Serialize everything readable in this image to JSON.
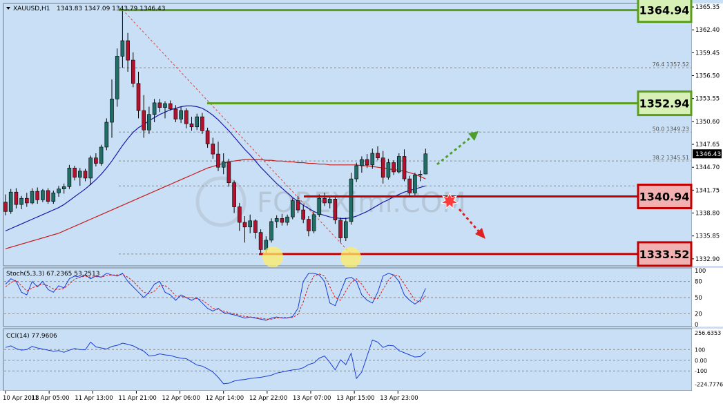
{
  "header": {
    "symbol_text": "XAUUSD,H1",
    "ohlc_text": "1343.83 1347.09 1343.79 1346.43"
  },
  "colors": {
    "panel_bg": "#c9dff5",
    "frame_bg": "#ffffff",
    "bull_candle": "#1f6e68",
    "bear_candle": "#b3122f",
    "ma_fast": "#1a1aa8",
    "ma_slow": "#c81c1c",
    "support_line": "#c00000",
    "resistance_line": "#5a9e1c",
    "fib_line": "#8a8a8a",
    "stoch_main": "#1a3cd6",
    "stoch_signal": "#e01919",
    "cci_line": "#1a3cd6"
  },
  "chart_data": [
    {
      "type": "candlestick",
      "panel": "price",
      "ylim": [
        1332.0,
        1365.8
      ],
      "y_ticks": [
        "1365.35",
        "1362.40",
        "1359.45",
        "1356.50",
        "1353.55",
        "1350.60",
        "1347.65",
        "1344.70",
        "1341.75",
        "1338.80",
        "1335.85",
        "1332.90"
      ],
      "current_price": "1346.43",
      "x_ticks": [
        "10 Apr 2018",
        "11 Apr 05:00",
        "11 Apr 13:00",
        "11 Apr 21:00",
        "12 Apr 06:00",
        "12 Apr 14:00",
        "12 Apr 22:00",
        "13 Apr 07:00",
        "13 Apr 15:00",
        "13 Apr 23:00"
      ],
      "candles": [
        [
          1340.2,
          1341.2,
          1338.5,
          1339.0
        ],
        [
          1339.0,
          1341.9,
          1338.7,
          1341.5
        ],
        [
          1341.5,
          1342.0,
          1339.4,
          1339.9
        ],
        [
          1339.9,
          1341.0,
          1339.3,
          1340.7
        ],
        [
          1340.7,
          1341.4,
          1339.6,
          1340.1
        ],
        [
          1340.1,
          1342.0,
          1339.9,
          1341.6
        ],
        [
          1341.6,
          1342.1,
          1340.0,
          1340.5
        ],
        [
          1340.5,
          1341.9,
          1340.2,
          1341.7
        ],
        [
          1341.7,
          1342.0,
          1340.0,
          1340.3
        ],
        [
          1340.3,
          1341.7,
          1340.0,
          1341.4
        ],
        [
          1341.4,
          1342.3,
          1340.9,
          1341.9
        ],
        [
          1341.9,
          1342.6,
          1341.3,
          1342.2
        ],
        [
          1342.2,
          1345.0,
          1341.9,
          1344.6
        ],
        [
          1344.6,
          1344.9,
          1343.0,
          1343.4
        ],
        [
          1343.4,
          1344.6,
          1342.3,
          1344.2
        ],
        [
          1344.2,
          1344.5,
          1342.9,
          1343.3
        ],
        [
          1343.3,
          1346.2,
          1342.4,
          1345.9
        ],
        [
          1345.9,
          1346.5,
          1344.8,
          1345.2
        ],
        [
          1345.2,
          1347.6,
          1344.9,
          1347.3
        ],
        [
          1347.3,
          1351.0,
          1346.9,
          1350.5
        ],
        [
          1350.5,
          1356.0,
          1348.5,
          1353.5
        ],
        [
          1353.5,
          1360.0,
          1352.5,
          1359.0
        ],
        [
          1359.0,
          1365.0,
          1357.5,
          1361.0
        ],
        [
          1361.0,
          1362.0,
          1357.0,
          1358.5
        ],
        [
          1358.5,
          1359.5,
          1355.0,
          1355.5
        ],
        [
          1355.5,
          1357.0,
          1351.0,
          1352.0
        ],
        [
          1352.0,
          1354.0,
          1348.5,
          1349.5
        ],
        [
          1349.5,
          1352.5,
          1349.0,
          1351.5
        ],
        [
          1351.5,
          1353.5,
          1350.5,
          1353.0
        ],
        [
          1353.0,
          1353.5,
          1351.8,
          1352.4
        ],
        [
          1352.4,
          1353.2,
          1351.0,
          1352.9
        ],
        [
          1352.9,
          1353.3,
          1352.0,
          1352.2
        ],
        [
          1352.2,
          1352.7,
          1350.5,
          1350.9
        ],
        [
          1350.9,
          1352.5,
          1350.4,
          1352.0
        ],
        [
          1352.0,
          1352.3,
          1349.7,
          1350.3
        ],
        [
          1350.3,
          1351.2,
          1349.4,
          1349.9
        ],
        [
          1349.9,
          1351.6,
          1349.5,
          1351.2
        ],
        [
          1351.2,
          1351.7,
          1349.0,
          1349.4
        ],
        [
          1349.4,
          1349.8,
          1347.2,
          1347.7
        ],
        [
          1347.7,
          1348.5,
          1345.8,
          1346.4
        ],
        [
          1346.4,
          1348.0,
          1344.2,
          1344.7
        ],
        [
          1344.7,
          1346.5,
          1343.8,
          1345.4
        ],
        [
          1345.4,
          1345.8,
          1342.2,
          1342.7
        ],
        [
          1342.7,
          1343.0,
          1338.8,
          1339.6
        ],
        [
          1339.6,
          1340.1,
          1336.5,
          1337.6
        ],
        [
          1337.6,
          1338.4,
          1335.0,
          1337.0
        ],
        [
          1337.0,
          1338.6,
          1336.2,
          1337.8
        ],
        [
          1337.8,
          1338.0,
          1335.5,
          1336.3
        ],
        [
          1336.3,
          1336.7,
          1333.5,
          1334.1
        ],
        [
          1334.1,
          1335.8,
          1333.52,
          1335.3
        ],
        [
          1335.3,
          1338.1,
          1335.0,
          1337.7
        ],
        [
          1337.7,
          1338.5,
          1336.9,
          1338.1
        ],
        [
          1338.1,
          1338.7,
          1337.2,
          1337.6
        ],
        [
          1337.6,
          1338.6,
          1337.2,
          1338.3
        ],
        [
          1338.3,
          1340.7,
          1338.0,
          1340.4
        ],
        [
          1340.4,
          1341.0,
          1338.8,
          1339.2
        ],
        [
          1339.2,
          1339.9,
          1337.5,
          1338.0
        ],
        [
          1338.0,
          1338.4,
          1335.8,
          1336.5
        ],
        [
          1336.5,
          1339.0,
          1336.2,
          1338.6
        ],
        [
          1338.6,
          1341.2,
          1338.3,
          1340.7
        ],
        [
          1340.7,
          1341.4,
          1339.7,
          1340.1
        ],
        [
          1340.1,
          1341.0,
          1339.4,
          1340.6
        ],
        [
          1340.6,
          1340.9,
          1337.4,
          1337.9
        ],
        [
          1337.9,
          1338.2,
          1335.0,
          1335.6
        ],
        [
          1335.6,
          1338.2,
          1335.2,
          1337.7
        ],
        [
          1337.7,
          1344.0,
          1337.3,
          1343.2
        ],
        [
          1343.2,
          1345.3,
          1342.8,
          1344.9
        ],
        [
          1344.9,
          1346.1,
          1344.0,
          1345.7
        ],
        [
          1345.7,
          1346.4,
          1344.6,
          1345.0
        ],
        [
          1345.0,
          1347.1,
          1344.5,
          1346.5
        ],
        [
          1346.5,
          1347.4,
          1345.6,
          1345.9
        ],
        [
          1345.9,
          1346.8,
          1342.6,
          1343.4
        ],
        [
          1343.4,
          1345.8,
          1343.1,
          1345.3
        ],
        [
          1345.3,
          1345.6,
          1343.7,
          1344.1
        ],
        [
          1344.1,
          1346.5,
          1343.9,
          1346.1
        ],
        [
          1346.1,
          1347.0,
          1342.9,
          1343.2
        ],
        [
          1343.2,
          1343.6,
          1340.9,
          1341.4
        ],
        [
          1341.4,
          1344.0,
          1341.1,
          1343.7
        ],
        [
          1343.7,
          1344.3,
          1342.9,
          1343.8
        ],
        [
          1343.83,
          1347.09,
          1343.79,
          1346.43
        ]
      ],
      "ma_fast": [
        1336.5,
        1336.8,
        1337.1,
        1337.4,
        1337.7,
        1338.0,
        1338.3,
        1338.6,
        1338.9,
        1339.2,
        1339.5,
        1339.9,
        1340.4,
        1340.9,
        1341.4,
        1341.9,
        1342.5,
        1343.1,
        1343.8,
        1344.6,
        1345.5,
        1346.5,
        1347.5,
        1348.4,
        1349.2,
        1349.8,
        1350.2,
        1350.7,
        1351.1,
        1351.5,
        1351.8,
        1352.1,
        1352.3,
        1352.5,
        1352.6,
        1352.6,
        1352.5,
        1352.3,
        1351.9,
        1351.4,
        1350.8,
        1350.1,
        1349.4,
        1348.6,
        1347.8,
        1347.0,
        1346.3,
        1345.5,
        1344.7,
        1344.0,
        1343.3,
        1342.6,
        1342.0,
        1341.4,
        1340.8,
        1340.3,
        1339.8,
        1339.4,
        1339.0,
        1338.7,
        1338.5,
        1338.3,
        1338.2,
        1338.1,
        1338.1,
        1338.2,
        1338.4,
        1338.7,
        1339.0,
        1339.4,
        1339.8,
        1340.2,
        1340.5,
        1340.9,
        1341.2,
        1341.5,
        1341.7,
        1341.9,
        1342.1,
        1342.3
      ],
      "ma_slow": [
        1334.2,
        1334.4,
        1334.6,
        1334.8,
        1335.0,
        1335.2,
        1335.4,
        1335.6,
        1335.8,
        1336.0,
        1336.2,
        1336.5,
        1336.8,
        1337.1,
        1337.4,
        1337.7,
        1338.0,
        1338.3,
        1338.6,
        1338.9,
        1339.2,
        1339.5,
        1339.8,
        1340.1,
        1340.4,
        1340.7,
        1341.0,
        1341.3,
        1341.6,
        1341.9,
        1342.2,
        1342.5,
        1342.8,
        1343.1,
        1343.4,
        1343.7,
        1344.0,
        1344.3,
        1344.6,
        1344.8,
        1345.0,
        1345.2,
        1345.4,
        1345.5,
        1345.6,
        1345.7,
        1345.7,
        1345.7,
        1345.7,
        1345.6,
        1345.6,
        1345.5,
        1345.5,
        1345.4,
        1345.4,
        1345.3,
        1345.3,
        1345.2,
        1345.2,
        1345.1,
        1345.1,
        1345.0,
        1345.0,
        1345.0,
        1345.0,
        1345.0,
        1345.0,
        1344.9,
        1344.9,
        1344.8,
        1344.7,
        1344.6,
        1344.5,
        1344.4,
        1344.3,
        1344.2,
        1344.0,
        1343.8,
        1343.5,
        1343.2
      ],
      "levels": [
        {
          "value": 1364.94,
          "label": "1364.94",
          "kind": "resistance"
        },
        {
          "value": 1352.94,
          "label": "1352.94",
          "kind": "resistance"
        },
        {
          "value": 1340.94,
          "label": "1340.94",
          "kind": "support"
        },
        {
          "value": 1333.52,
          "label": "1333.52",
          "kind": "support"
        }
      ],
      "fib_levels": [
        {
          "value": 1357.52,
          "label": "76.4 1357.52"
        },
        {
          "value": 1349.23,
          "label": "50.0 1349.23"
        },
        {
          "value": 1345.51,
          "label": "38.2 1345.51"
        },
        {
          "value": 1342.3,
          "label": ""
        },
        {
          "value": 1333.52,
          "label": ""
        }
      ],
      "watermark": "FOREXimf.COM"
    },
    {
      "type": "line",
      "panel": "stochastic",
      "label": "Stoch(5,3,3) 67.2365 53.2513",
      "ylim": [
        0,
        100
      ],
      "y_ticks": [
        "100",
        "80",
        "50",
        "20",
        "0"
      ],
      "series": [
        {
          "name": "main",
          "values": [
            75,
            85,
            80,
            60,
            55,
            80,
            70,
            80,
            65,
            60,
            72,
            68,
            85,
            90,
            88,
            92,
            85,
            90,
            88,
            95,
            92,
            90,
            95,
            80,
            70,
            60,
            50,
            60,
            75,
            80,
            60,
            55,
            45,
            55,
            50,
            45,
            50,
            40,
            30,
            25,
            30,
            22,
            20,
            18,
            15,
            12,
            14,
            12,
            10,
            8,
            12,
            14,
            12,
            12,
            15,
            30,
            80,
            95,
            95,
            92,
            80,
            40,
            35,
            60,
            85,
            88,
            80,
            55,
            45,
            40,
            60,
            90,
            95,
            92,
            80,
            55,
            45,
            38,
            45,
            67.2365
          ]
        },
        {
          "name": "signal",
          "values": [
            70,
            78,
            82,
            72,
            62,
            68,
            72,
            75,
            72,
            66,
            65,
            67,
            75,
            84,
            88,
            90,
            88,
            89,
            88,
            91,
            92,
            92,
            93,
            88,
            80,
            70,
            60,
            57,
            62,
            72,
            72,
            65,
            53,
            52,
            50,
            50,
            48,
            45,
            38,
            30,
            28,
            25,
            22,
            20,
            17,
            15,
            14,
            13,
            12,
            10,
            10,
            12,
            13,
            13,
            13,
            19,
            42,
            72,
            90,
            94,
            90,
            70,
            50,
            45,
            62,
            78,
            85,
            75,
            60,
            48,
            48,
            65,
            82,
            92,
            90,
            75,
            60,
            45,
            42,
            53.2513
          ]
        }
      ]
    },
    {
      "type": "line",
      "panel": "cci",
      "label": "CCI(14) 77.9606",
      "ylim": [
        -260,
        270
      ],
      "y_ticks": [
        "256.6353",
        "100",
        "0.00",
        "-100",
        "-224.7776"
      ],
      "series": [
        {
          "name": "cci",
          "values": [
            120,
            135,
            110,
            95,
            100,
            130,
            115,
            105,
            95,
            85,
            90,
            75,
            95,
            110,
            100,
            98,
            170,
            125,
            115,
            105,
            130,
            140,
            160,
            150,
            135,
            110,
            85,
            40,
            45,
            60,
            50,
            45,
            30,
            20,
            15,
            -15,
            -45,
            -55,
            -80,
            -110,
            -160,
            -220,
            -215,
            -195,
            -185,
            -180,
            -170,
            -165,
            -160,
            -150,
            -140,
            -120,
            -110,
            -100,
            -90,
            -85,
            -70,
            -40,
            -25,
            20,
            40,
            -20,
            -90,
            5,
            -40,
            65,
            -170,
            -110,
            40,
            190,
            170,
            120,
            140,
            135,
            90,
            70,
            50,
            30,
            35,
            77.9606
          ]
        }
      ]
    }
  ]
}
